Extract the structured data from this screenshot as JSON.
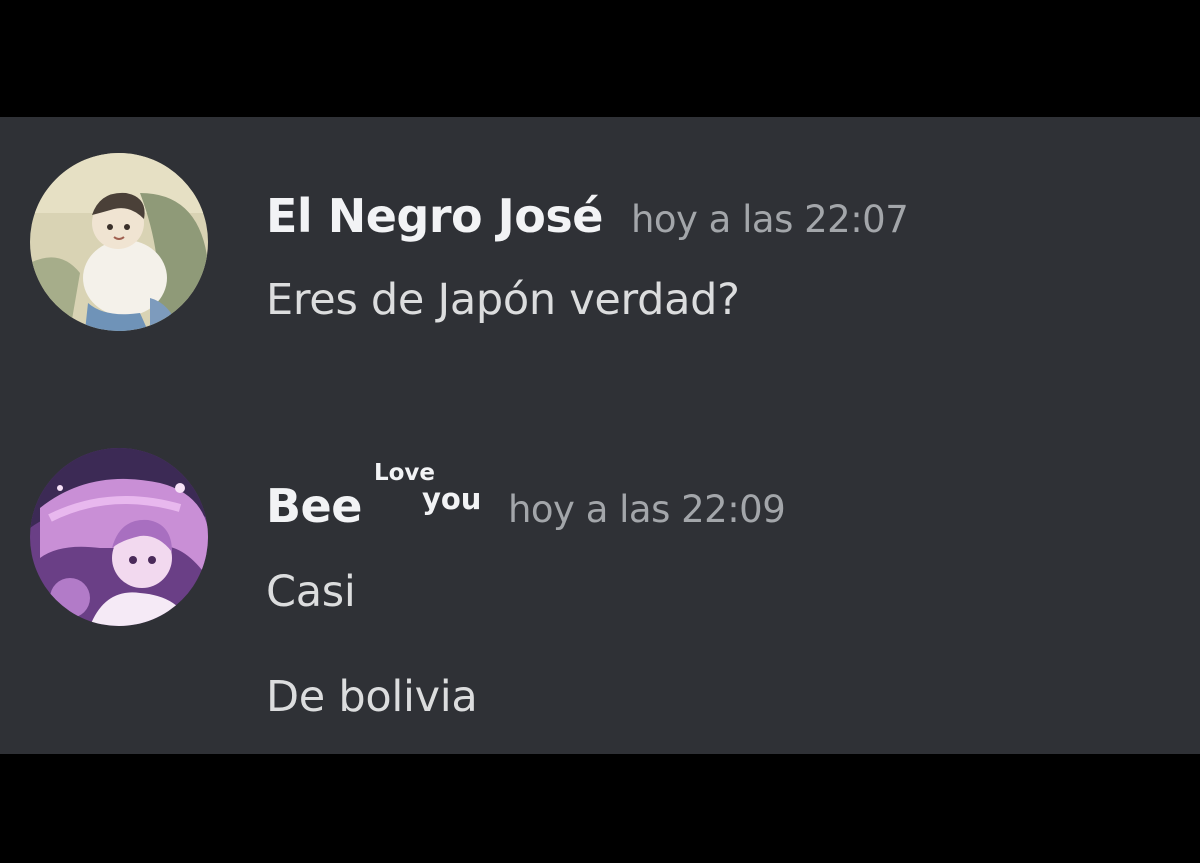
{
  "messages": [
    {
      "username": "El Negro José",
      "timestamp": "hoy a las 22:07",
      "lines": [
        "Eres de Japón verdad?"
      ],
      "avatar_icon": "cartoon-child-avatar-icon"
    },
    {
      "username": "Bee",
      "tag_top": "Love",
      "tag_bottom": "you",
      "timestamp": "hoy a las 22:09",
      "lines": [
        "Casi",
        "De bolivia"
      ],
      "avatar_icon": "anime-girl-purple-avatar-icon"
    }
  ],
  "colors": {
    "background": "#000000",
    "chat_panel": "#2f3136",
    "username": "#f2f3f5",
    "message_text": "#dcddde",
    "timestamp": "#a3a6aa"
  }
}
